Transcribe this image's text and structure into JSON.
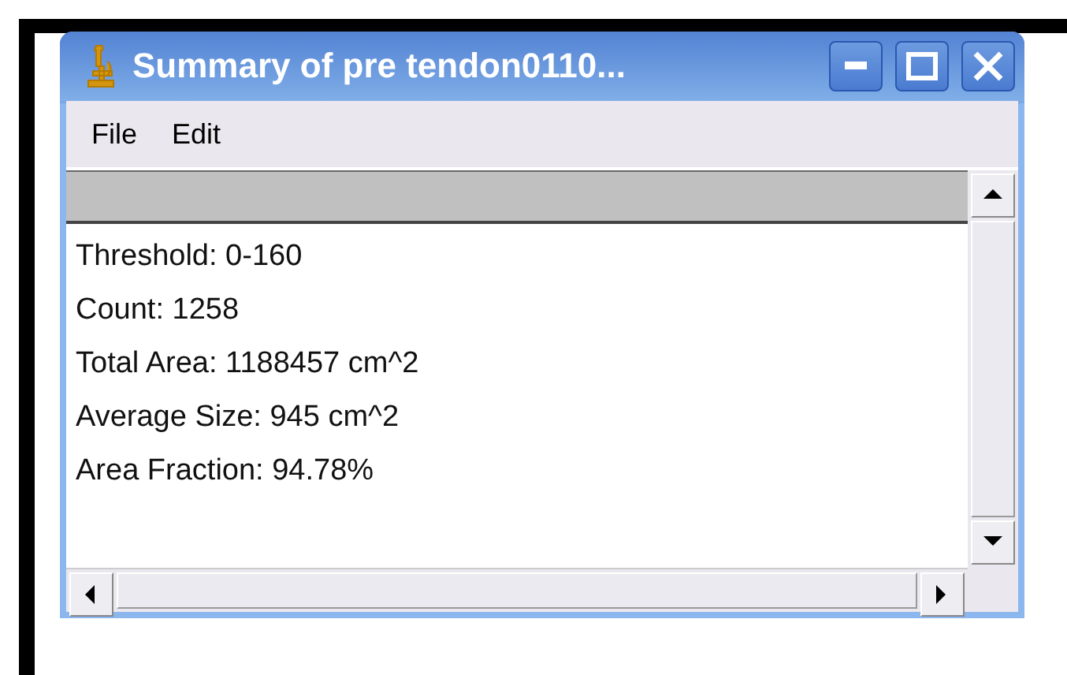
{
  "window": {
    "title": "Summary of pre tendon0110..."
  },
  "menu": [
    "File",
    "Edit"
  ],
  "lines": [
    "Threshold: 0-160",
    "Count: 1258",
    "Total Area: 1188457 cm^2",
    "Average Size: 945 cm^2",
    "Area Fraction: 94.78%"
  ]
}
